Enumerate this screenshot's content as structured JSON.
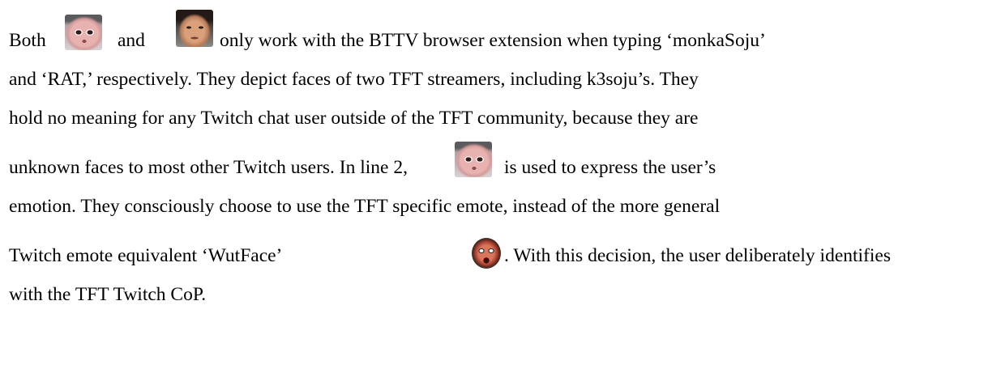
{
  "paragraph": {
    "line1": {
      "part1": "Both",
      "part2": "and",
      "part3": "only work with the BTTV browser extension when typing ‘monkaSoju’"
    },
    "line2": "and ‘RAT,’ respectively. They depict faces of two TFT streamers, including k3soju’s. They",
    "line3": "hold no meaning for any Twitch chat user outside of the TFT community, because they are",
    "line4": {
      "part1": "unknown faces to most other Twitch users. In line 2,",
      "part2": "is used to express the user’s"
    },
    "line5": "emotion. They consciously choose to use the TFT specific emote, instead of the more general",
    "line6": {
      "part1": "Twitch emote equivalent ‘WutFace’",
      "part2": ". With this decision, the user deliberately identifies"
    },
    "line7": "with the TFT Twitch CoP."
  },
  "emotes": {
    "monkaSoju": "monkaSoju-emote",
    "rat": "rat-emote",
    "wutface": "wutface-emote"
  }
}
